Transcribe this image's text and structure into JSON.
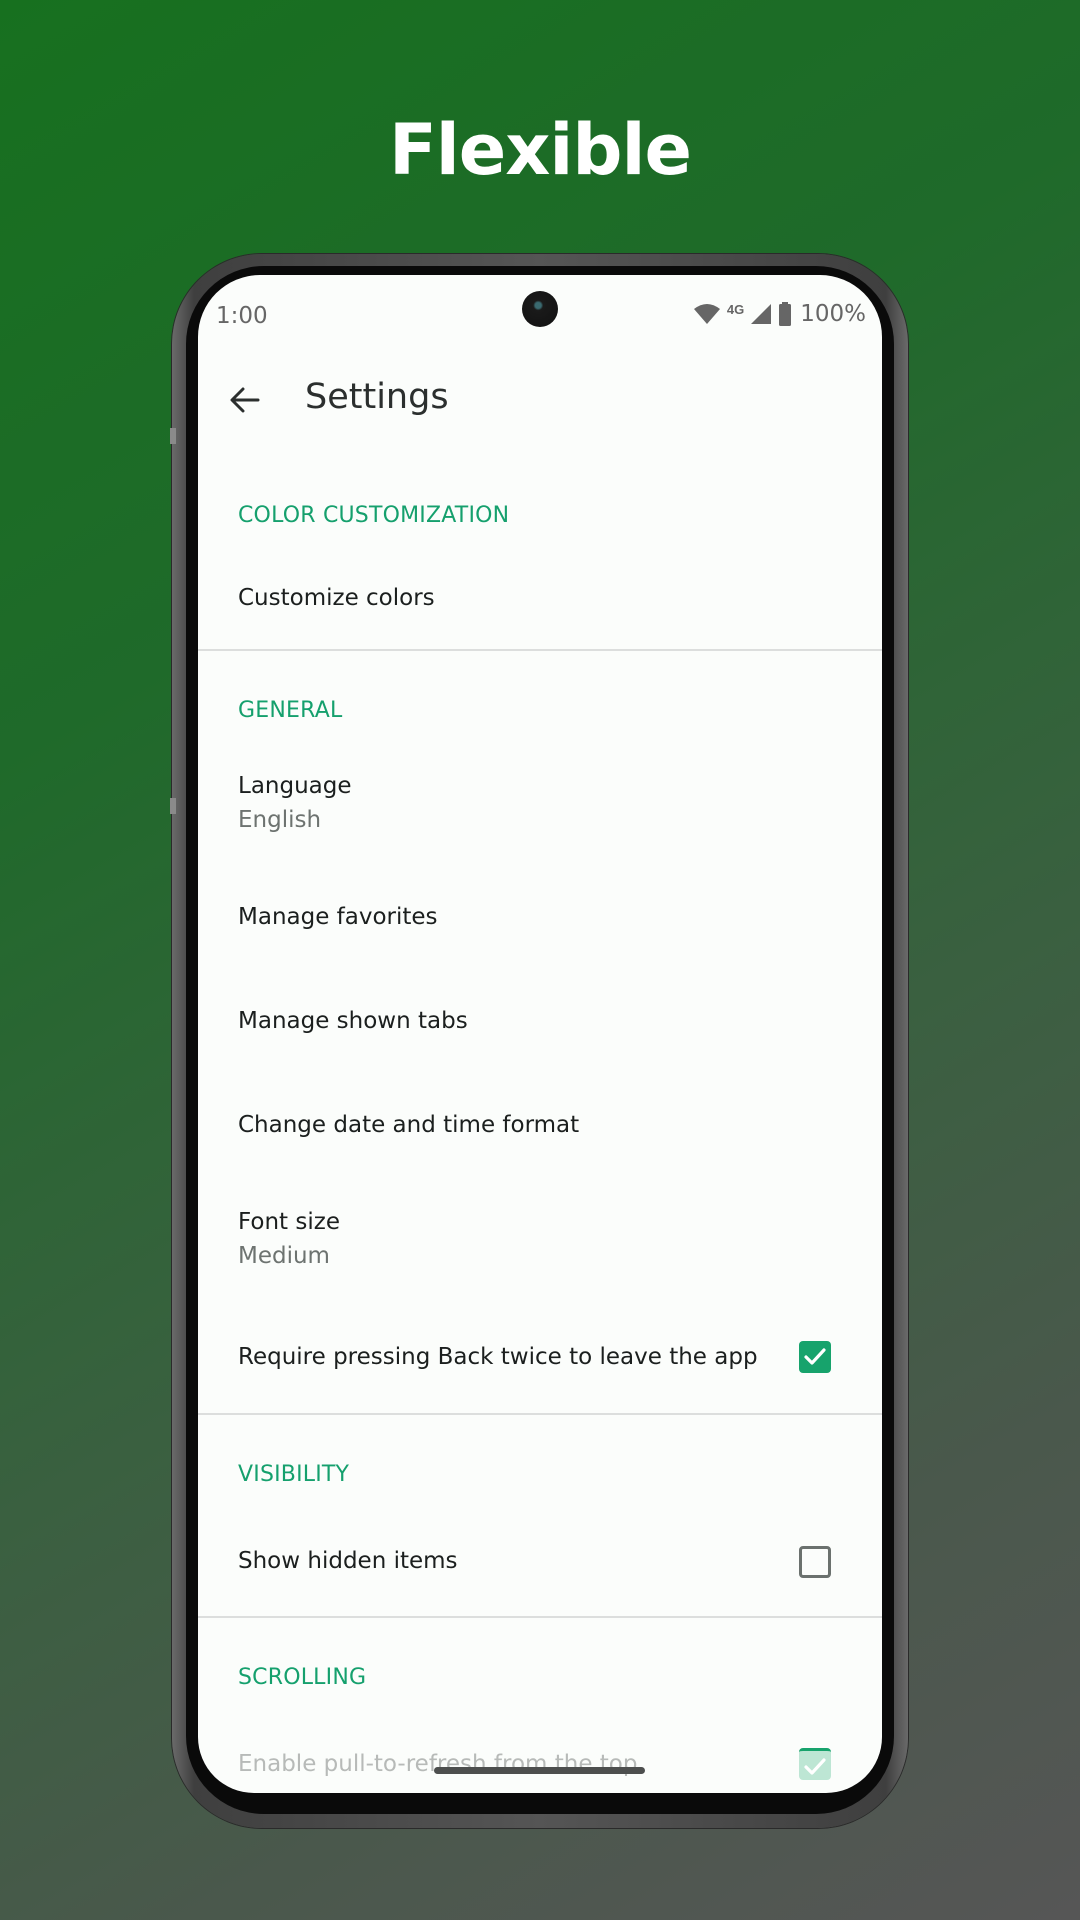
{
  "promo": {
    "title": "Flexible"
  },
  "colors": {
    "accent": "#17a36c",
    "background_top": "#17701f",
    "background_bottom": "#565656"
  },
  "statusbar": {
    "time": "1:00",
    "network_label": "4G",
    "battery_percent": "100%",
    "icons": [
      "wifi-icon",
      "network-4g-icon",
      "signal-icon",
      "battery-icon"
    ]
  },
  "appbar": {
    "back_icon": "arrow-left-icon",
    "title": "Settings"
  },
  "sections": {
    "color_customization": {
      "header": "COLOR CUSTOMIZATION",
      "items": [
        {
          "title": "Customize colors"
        }
      ]
    },
    "general": {
      "header": "GENERAL",
      "items": [
        {
          "title": "Language",
          "subtitle": "English"
        },
        {
          "title": "Manage favorites"
        },
        {
          "title": "Manage shown tabs"
        },
        {
          "title": "Change date and time format"
        },
        {
          "title": "Font size",
          "subtitle": "Medium"
        },
        {
          "title": "Require pressing Back twice to leave the app",
          "checked": true
        }
      ]
    },
    "visibility": {
      "header": "VISIBILITY",
      "items": [
        {
          "title": "Show hidden items",
          "checked": false
        }
      ]
    },
    "scrolling": {
      "header": "SCROLLING",
      "items": [
        {
          "title": "Enable pull-to-refresh from the top",
          "checked": true
        }
      ]
    }
  }
}
